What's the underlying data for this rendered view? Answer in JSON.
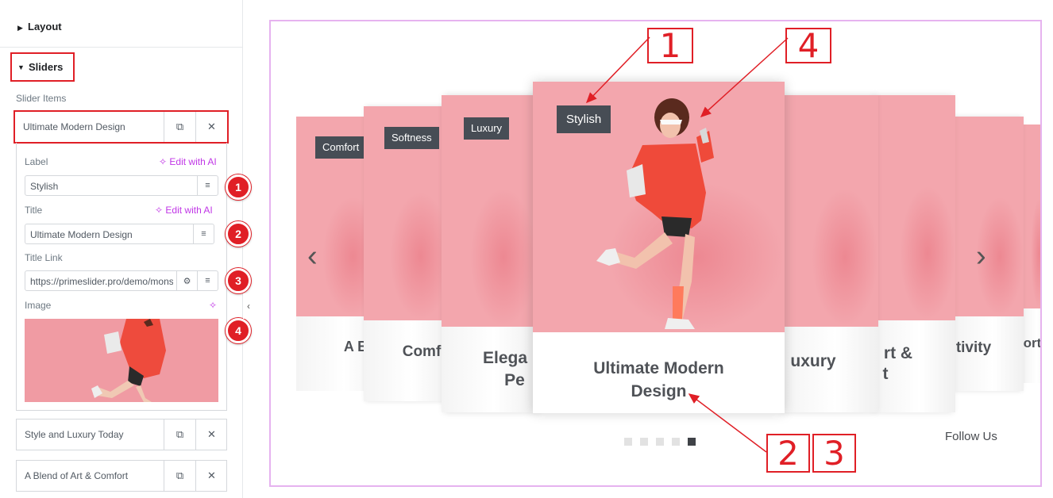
{
  "panel": {
    "layout_section": "Layout",
    "sliders_section": "Sliders",
    "slider_items_label": "Slider Items",
    "active_item": {
      "title": "Ultimate Modern Design",
      "label_field_label": "Label",
      "label_value": "Stylish",
      "title_field_label": "Title",
      "title_value": "Ultimate Modern Design",
      "title_link_label": "Title Link",
      "title_link_value": "https://primeslider.pro/demo/mons",
      "image_label": "Image",
      "edit_ai": "Edit with AI"
    },
    "other_items": [
      {
        "title": "Style and Luxury Today"
      },
      {
        "title": "A Blend of Art & Comfort"
      }
    ],
    "badges": [
      "1",
      "2",
      "3",
      "4"
    ]
  },
  "canvas": {
    "cards": [
      {
        "label": "Comfort",
        "title": "A B"
      },
      {
        "label": "Softness",
        "title": "Comf"
      },
      {
        "label": "Luxury",
        "title_l1": "Elega",
        "title_l2": "Pe"
      },
      {
        "label": "Stylish",
        "title_l1": "Ultimate Modern",
        "title_l2": "Design"
      },
      {
        "title": "uxury"
      },
      {
        "title_l1": "rt &",
        "title_l2": "t"
      },
      {
        "title": "tivity"
      },
      {
        "title": "ort"
      }
    ],
    "dots_count": 5,
    "active_dot": 4,
    "follow_text": "Follow Us",
    "prev_glyph": "‹",
    "next_glyph": "›",
    "callouts": [
      "1",
      "4",
      "2",
      "3"
    ]
  },
  "colors": {
    "accent_red": "#e01f26",
    "ai_purple": "#c036e6",
    "photo_pink": "#f3a6ad",
    "label_bg": "#474d55"
  }
}
